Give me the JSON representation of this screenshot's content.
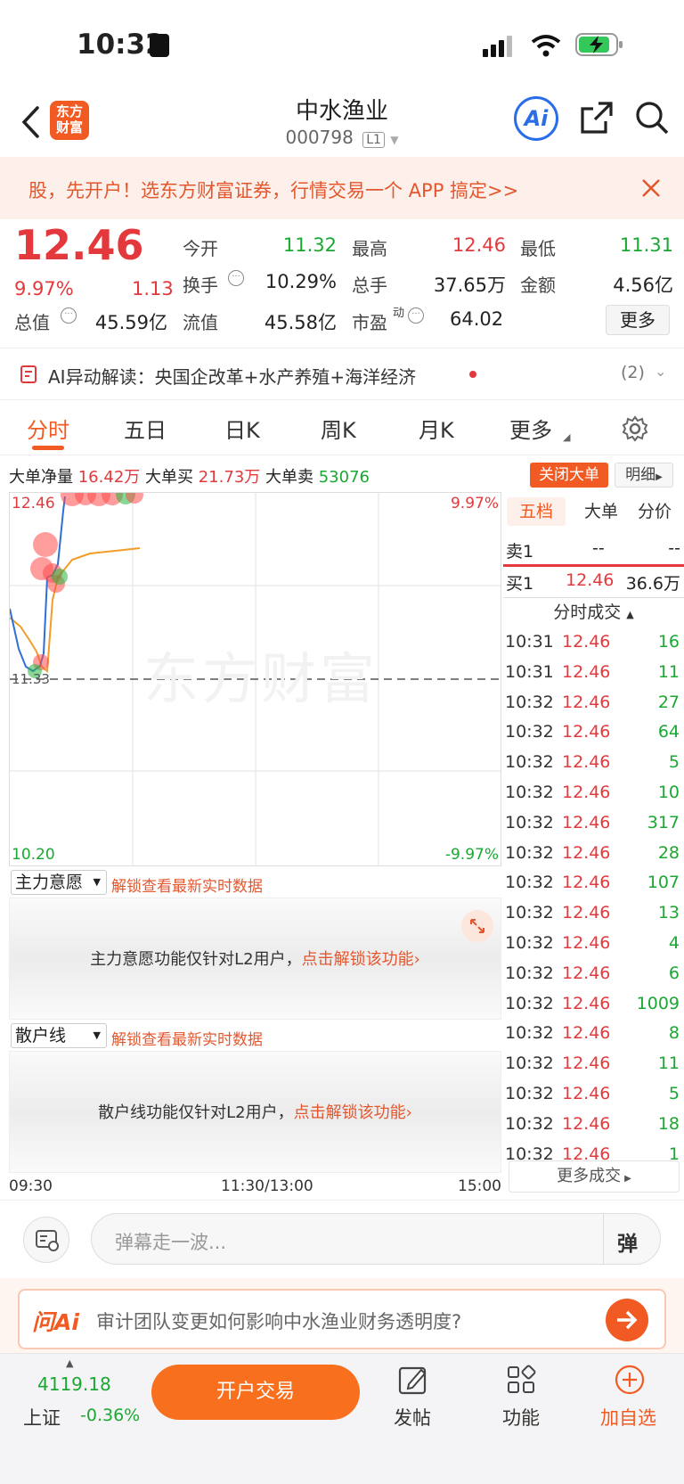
{
  "status": {
    "time": "10:32"
  },
  "header": {
    "title": "中水渔业",
    "code": "000798",
    "level": "L1",
    "logo_line1": "东方",
    "logo_line2": "财富",
    "ai_label": "Ai"
  },
  "banner": {
    "text": "股，先开户！选东方财富证券，行情交易一个 APP 搞定>>"
  },
  "quote": {
    "price": "12.46",
    "change_pct": "9.97%",
    "change": "1.13",
    "open_label": "今开",
    "open": "11.32",
    "high_label": "最高",
    "high": "12.46",
    "low_label": "最低",
    "low": "11.31",
    "turnover_label": "换手",
    "turnover": "10.29%",
    "volume_label": "总手",
    "volume": "37.65万",
    "amount_label": "金额",
    "amount": "4.56亿",
    "mcap_label": "总值",
    "mcap": "45.59亿",
    "float_label": "流值",
    "float": "45.58亿",
    "pe_label": "市盈",
    "pe_sup": "动",
    "pe": "64.02",
    "more": "更多"
  },
  "ai": {
    "text": "AI异动解读：央国企改革+水产养殖+海洋经济",
    "count": "(2)"
  },
  "tabs": [
    "分时",
    "五日",
    "日K",
    "周K",
    "月K",
    "更多"
  ],
  "bigorder": {
    "net_label": "大单净量",
    "net": "16.42万",
    "buy_label": "大单买",
    "buy": "21.73万",
    "sell_label": "大单卖",
    "sell": "53076",
    "close_btn": "关闭大单",
    "detail_btn": "明细"
  },
  "chart_data": {
    "type": "line",
    "top_price": "12.46",
    "top_pct": "9.97%",
    "bottom_price": "10.20",
    "bottom_pct": "-9.97%",
    "base": "11.33",
    "watermark": "东方财富",
    "x_labels": [
      "09:30",
      "11:30/13:00",
      "15:00"
    ]
  },
  "panel1": {
    "select": "主力意愿",
    "unlock": "解锁查看最新实时数据",
    "msg": "主力意愿功能仅针对L2用户，",
    "link": "点击解锁该功能"
  },
  "panel2": {
    "select": "散户线",
    "unlock": "解锁查看最新实时数据",
    "msg": "散户线功能仅针对L2用户，",
    "link": "点击解锁该功能"
  },
  "right": {
    "tabs": [
      "五档",
      "大单",
      "分价"
    ],
    "sell1_label": "卖1",
    "sell1_price": "--",
    "sell1_vol": "--",
    "buy1_label": "买1",
    "buy1_price": "12.46",
    "buy1_vol": "36.6万",
    "trades_title": "分时成交",
    "more": "更多成交",
    "trades": [
      {
        "t": "10:31",
        "p": "12.46",
        "v": "16"
      },
      {
        "t": "10:31",
        "p": "12.46",
        "v": "11"
      },
      {
        "t": "10:32",
        "p": "12.46",
        "v": "27"
      },
      {
        "t": "10:32",
        "p": "12.46",
        "v": "64"
      },
      {
        "t": "10:32",
        "p": "12.46",
        "v": "5"
      },
      {
        "t": "10:32",
        "p": "12.46",
        "v": "10"
      },
      {
        "t": "10:32",
        "p": "12.46",
        "v": "317"
      },
      {
        "t": "10:32",
        "p": "12.46",
        "v": "28"
      },
      {
        "t": "10:32",
        "p": "12.46",
        "v": "107"
      },
      {
        "t": "10:32",
        "p": "12.46",
        "v": "13"
      },
      {
        "t": "10:32",
        "p": "12.46",
        "v": "4"
      },
      {
        "t": "10:32",
        "p": "12.46",
        "v": "6"
      },
      {
        "t": "10:32",
        "p": "12.46",
        "v": "1009"
      },
      {
        "t": "10:32",
        "p": "12.46",
        "v": "8"
      },
      {
        "t": "10:32",
        "p": "12.46",
        "v": "11"
      },
      {
        "t": "10:32",
        "p": "12.46",
        "v": "5"
      },
      {
        "t": "10:32",
        "p": "12.46",
        "v": "18"
      },
      {
        "t": "10:32",
        "p": "12.46",
        "v": "1"
      }
    ]
  },
  "chat": {
    "placeholder": "弹幕走一波...",
    "dan": "弹"
  },
  "ask": {
    "brand": "问Ai",
    "text": "审计团队变更如何影响中水渔业财务透明度?"
  },
  "bottom": {
    "index_value": "4119.18",
    "index_name": "上证",
    "index_pct": "-0.36%",
    "trade_btn": "开户交易",
    "post": "发帖",
    "func": "功能",
    "watch": "加自选"
  }
}
